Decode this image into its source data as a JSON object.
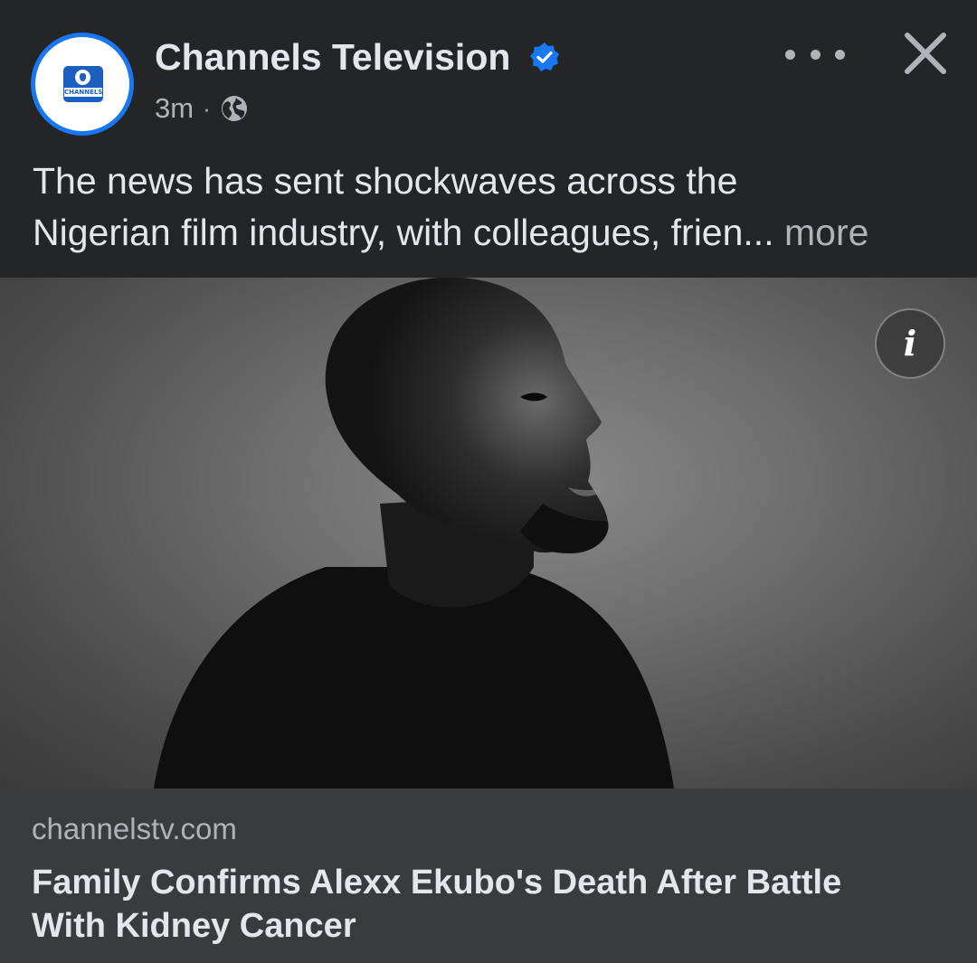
{
  "post": {
    "page_name": "Channels Television",
    "avatar_logo_text": "CHANNELS",
    "verified_icon": "verified-badge-icon",
    "timestamp": "3m",
    "separator": "·",
    "audience_icon": "globe-icon",
    "more_icon": "more-options-icon",
    "close_icon": "close-icon",
    "caption_line1": "The news has sent shockwaves across the",
    "caption_line2": "Nigerian film industry, with colleagues, frien...",
    "more_label": "more",
    "info_icon_glyph": "i"
  },
  "link_preview": {
    "domain": "channelstv.com",
    "headline_line1": "Family Confirms Alexx Ekubo's Death After Battle",
    "headline_line2": "With Kidney Cancer"
  },
  "colors": {
    "background": "#242526",
    "footer": "#3a3b3c",
    "accent": "#1877f2",
    "text_primary": "#e4e6eb",
    "text_secondary": "#b0b3b8"
  }
}
